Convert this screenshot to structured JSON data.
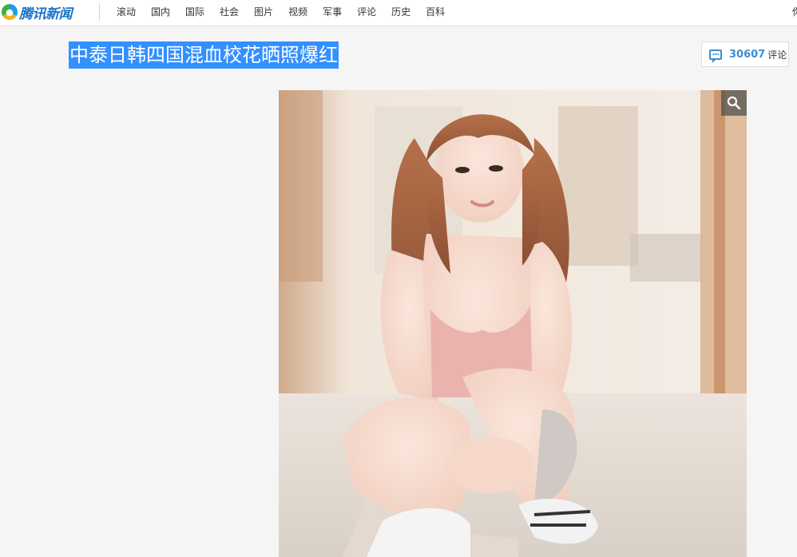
{
  "header": {
    "logo_text": "腾讯新闻",
    "nav": [
      "滚动",
      "国内",
      "国际",
      "社会",
      "图片",
      "视频",
      "军事",
      "评论",
      "历史",
      "百科"
    ],
    "right_edge_text": "你"
  },
  "article": {
    "title": "中泰日韩四国混血校花晒照爆红"
  },
  "comments": {
    "count": "30607",
    "label": "评论"
  },
  "photo": {
    "zoom_icon": "search-icon"
  },
  "colors": {
    "title_highlight": "#3390ff",
    "brand_blue": "#1b73c6",
    "comment_accent": "#3e8ed0"
  }
}
